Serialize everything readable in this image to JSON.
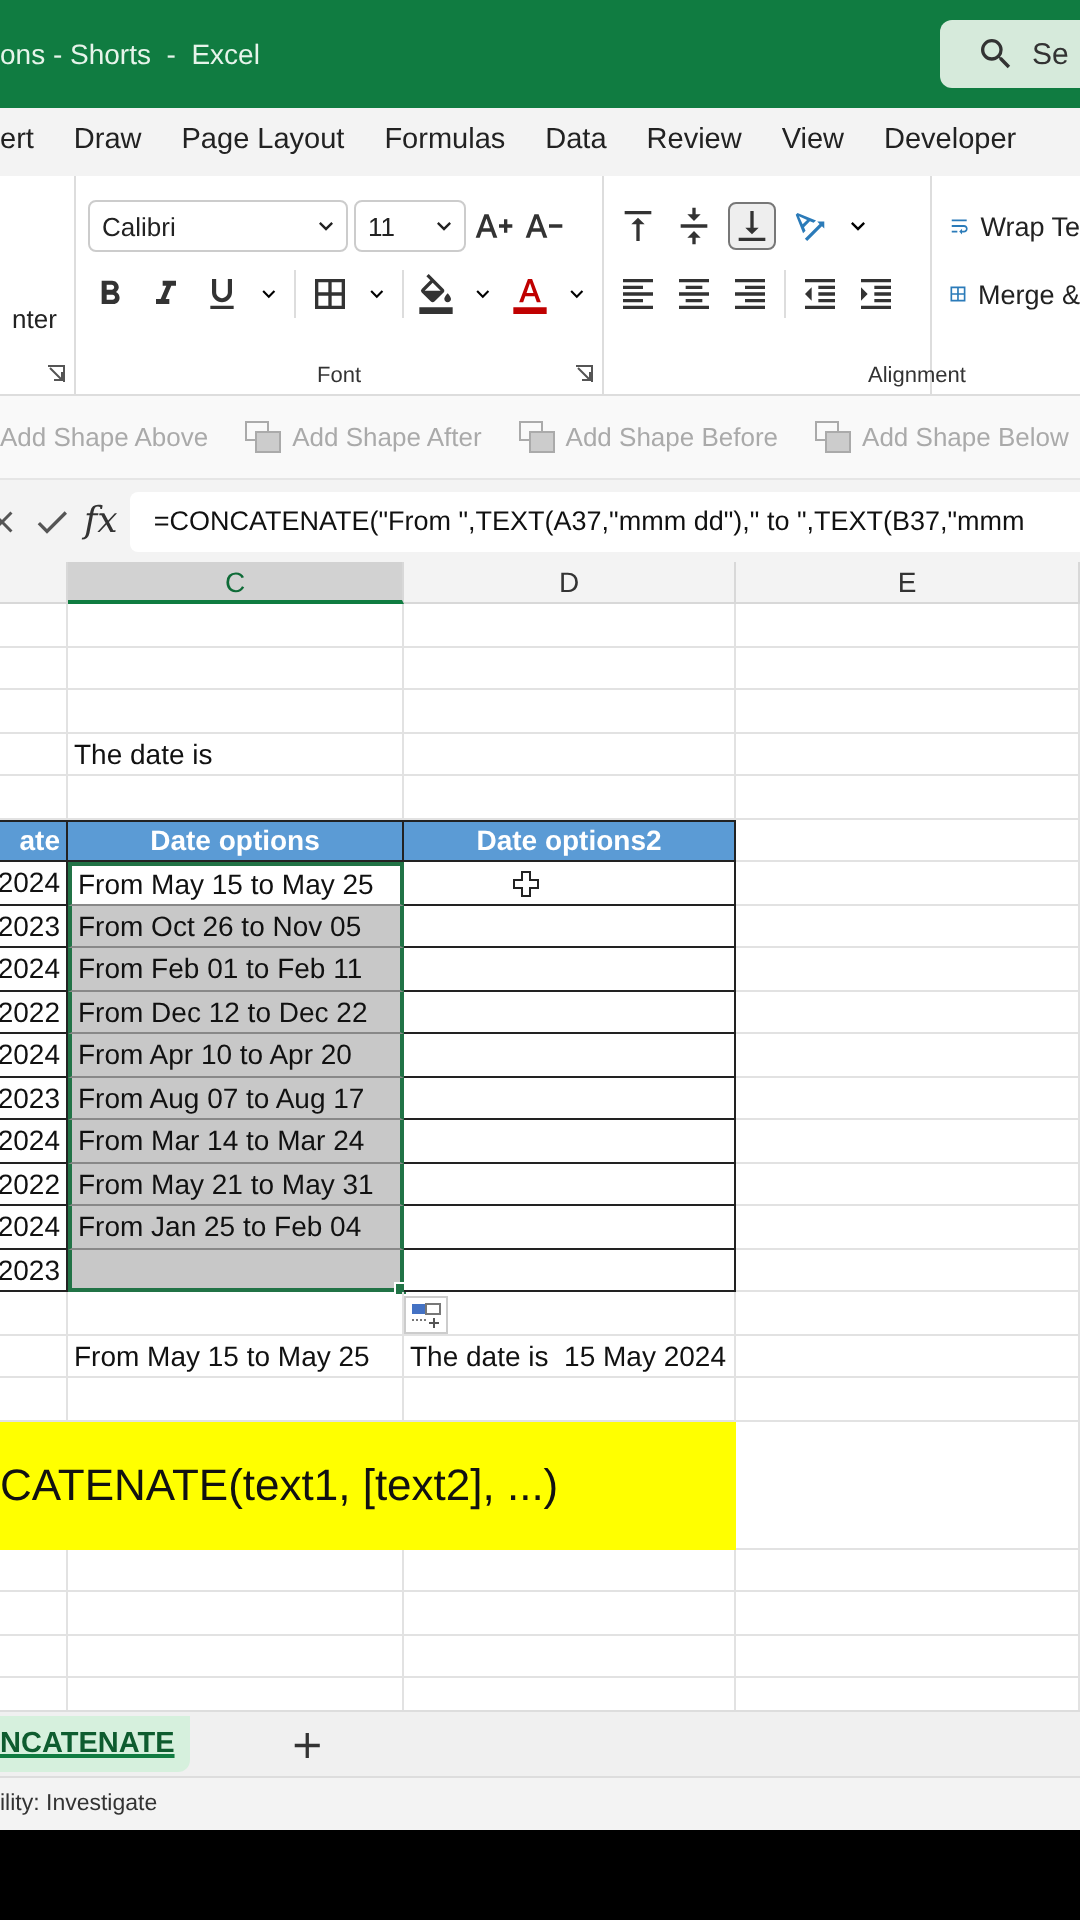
{
  "window": {
    "title": "ons - Shorts  -  Excel",
    "search": "Se"
  },
  "menu": [
    {
      "label": "ert",
      "selected": false
    },
    {
      "label": "Draw",
      "selected": false
    },
    {
      "label": "Page Layout",
      "selected": false
    },
    {
      "label": "Formulas",
      "selected": false
    },
    {
      "label": "Data",
      "selected": false
    },
    {
      "label": "Review",
      "selected": false
    },
    {
      "label": "View",
      "selected": false
    },
    {
      "label": "Developer",
      "selected": false
    }
  ],
  "ribbon": {
    "left_group": {
      "label": "nter"
    },
    "font_group": {
      "label": "Font",
      "font": "Calibri",
      "size": "11"
    },
    "alignment_group": {
      "label": "Alignment",
      "wrap": "Wrap Te",
      "merge": "Merge &"
    }
  },
  "shape_bar": [
    {
      "label": "Add Shape Above",
      "disabled": true
    },
    {
      "label": "Add Shape After",
      "disabled": true
    },
    {
      "label": "Add Shape Before",
      "disabled": true
    },
    {
      "label": "Add Shape Below",
      "disabled": true
    }
  ],
  "formula_bar": {
    "function_label": "fx",
    "formula": "=CONCATENATE(\"From \",TEXT(A37,\"mmm dd\"),\" to \",TEXT(B37,\"mmm"
  },
  "columns": [
    {
      "label": "C",
      "selected": true
    },
    {
      "label": "D",
      "selected": false
    },
    {
      "label": "E",
      "selected": false
    }
  ],
  "rows": [
    {
      "kind": "blank"
    },
    {
      "kind": "blank"
    },
    {
      "kind": "blank"
    },
    {
      "kind": "note",
      "text": "The date is"
    },
    {
      "kind": "blank"
    },
    {
      "kind": "header",
      "cells": [
        "ate",
        "Date options",
        "Date options2"
      ]
    },
    {
      "kind": "data",
      "year": "2024",
      "option": "From May 15 to May 25",
      "selected": true,
      "active": true
    },
    {
      "kind": "data",
      "year": "2023",
      "option": "From Oct 26 to Nov 05",
      "selected": true,
      "active": false
    },
    {
      "kind": "data",
      "year": "2024",
      "option": "From Feb 01 to Feb 11",
      "selected": true,
      "active": false
    },
    {
      "kind": "data",
      "year": "2022",
      "option": "From Dec 12 to Dec 22",
      "selected": true,
      "active": false
    },
    {
      "kind": "data",
      "year": "2024",
      "option": "From Apr 10 to Apr 20",
      "selected": true,
      "active": false
    },
    {
      "kind": "data",
      "year": "2023",
      "option": "From Aug 07 to Aug 17",
      "selected": true,
      "active": false
    },
    {
      "kind": "data",
      "year": "2024",
      "option": "From Mar 14 to Mar 24",
      "selected": true,
      "active": false
    },
    {
      "kind": "data",
      "year": "2022",
      "option": "From May 21 to May 31",
      "selected": true,
      "active": false
    },
    {
      "kind": "data",
      "year": "2024",
      "option": "From Jan 25 to Feb 04",
      "selected": true,
      "active": false
    },
    {
      "kind": "data",
      "year": "2023",
      "selected": true,
      "active": false
    },
    {
      "kind": "blank"
    },
    {
      "kind": "result",
      "c": "From May 15 to May 25",
      "d": "The date is  15 May 2024"
    },
    {
      "kind": "blank"
    },
    {
      "kind": "banner",
      "text": "CATENATE(text1, [text2], ...)"
    },
    {
      "kind": "blank"
    },
    {
      "kind": "blank"
    },
    {
      "kind": "blank"
    },
    {
      "kind": "blank"
    }
  ],
  "sheet_tabs": [
    {
      "label": "NCATENATE",
      "selected": true
    }
  ],
  "add_sheet": "+",
  "status_bar": {
    "text": "ility: Investigate"
  }
}
